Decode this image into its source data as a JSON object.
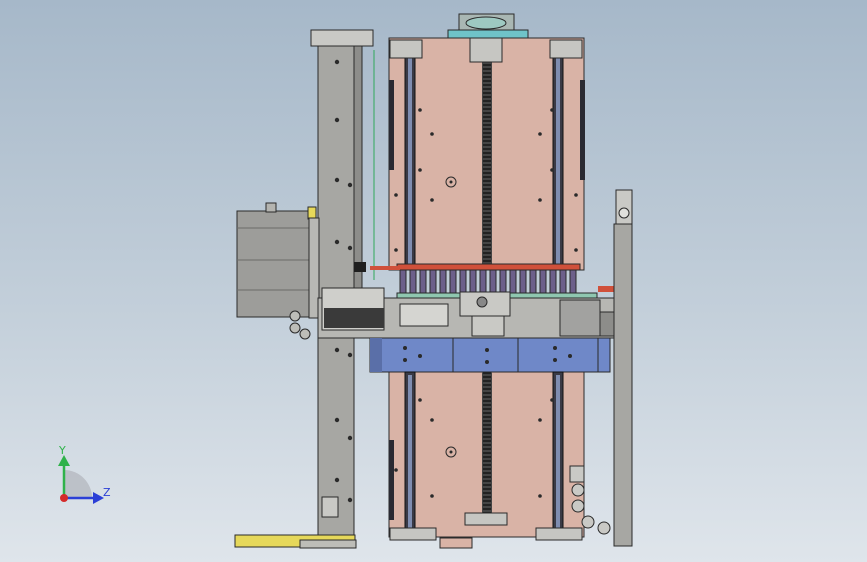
{
  "viewport": {
    "background_top": "#a6b8c9",
    "background_bottom": "#dfe5eb"
  },
  "triad": {
    "y_label": "Y",
    "z_label": "Z",
    "y_color": "#2fb24a",
    "z_color": "#2b3fd6",
    "x_color": "#d42a2a"
  },
  "colors": {
    "plate": "#d9b3a6",
    "plate_edge": "#2a2a2a",
    "column": "#a7a7a3",
    "dark_rail": "#3a3a45",
    "blue_block": "#6f88c8",
    "motor": "#9d9d9a",
    "green_guide": "#8fc7b0",
    "red_accent": "#d0503a",
    "base_yellow": "#e6d85a"
  }
}
